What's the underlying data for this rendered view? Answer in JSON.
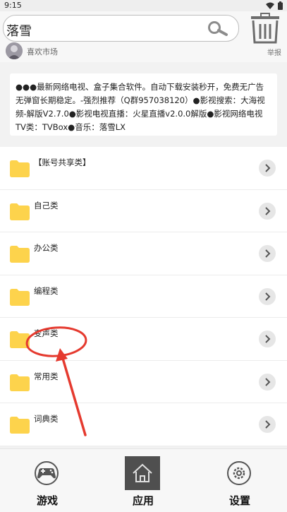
{
  "status_bar": {
    "time": "9:15"
  },
  "header": {
    "search": {
      "value": "落雪"
    },
    "author": {
      "name": "喜欢市场"
    },
    "report_label": "举报"
  },
  "description": "●●●最新网络电视、盒子集合软件。自动下载安装秒开，免费无广告无弹窗长期稳定。-强烈推荐（Q群957038120）●影视搜索：大海视频-解版V2.7.0●影视电视直播：火星直播v2.0.0解版●影视网络电视TV类：TVBox●音乐：落雪LX",
  "categories": [
    {
      "label": "【账号共享类】"
    },
    {
      "label": "自己类"
    },
    {
      "label": "办公类"
    },
    {
      "label": "编程类"
    },
    {
      "label": "变声类"
    },
    {
      "label": "常用类"
    },
    {
      "label": "词典类"
    }
  ],
  "bottom_nav": {
    "tabs": [
      {
        "label": "游戏",
        "icon": "gamepad-icon"
      },
      {
        "label": "应用",
        "icon": "home-icon",
        "selected": true
      },
      {
        "label": "设置",
        "icon": "gear-icon"
      }
    ]
  },
  "colors": {
    "folder": "#fdd34c",
    "annotation": "#e53a2f",
    "selected_tab": "#4f4f4f"
  }
}
